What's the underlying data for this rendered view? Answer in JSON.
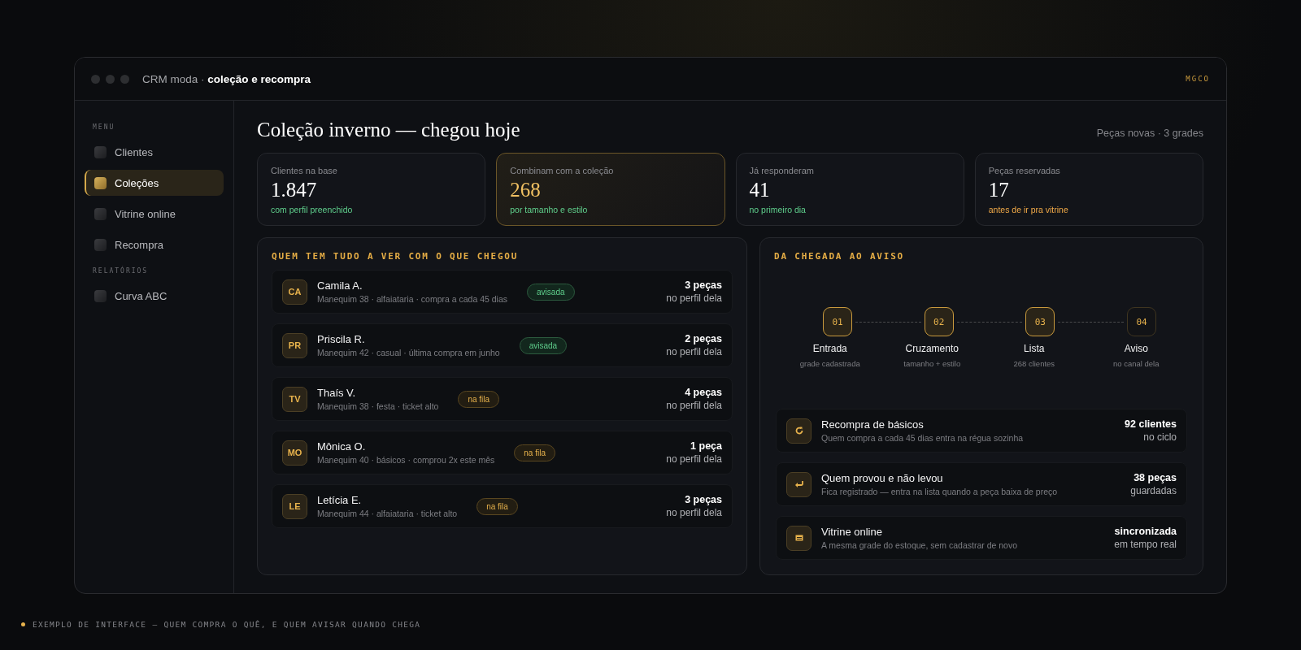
{
  "window": {
    "title_app": "CRM moda ·",
    "title_context": "coleção e recompra",
    "badge": "MGCO"
  },
  "sidebar": {
    "sections": [
      {
        "label": "MENU",
        "items": [
          {
            "label": "Clientes",
            "selected": false
          },
          {
            "label": "Coleções",
            "selected": true
          },
          {
            "label": "Vitrine online",
            "selected": false
          },
          {
            "label": "Recompra",
            "selected": false
          }
        ]
      },
      {
        "label": "RELATÓRIOS",
        "items": [
          {
            "label": "Curva ABC",
            "selected": false
          }
        ]
      }
    ]
  },
  "header": {
    "title": "Coleção inverno — chegou hoje",
    "meta": "Peças novas · 3 grades"
  },
  "stats": [
    {
      "label": "Clientes na base",
      "value": "1.847",
      "note": "com perfil preenchido",
      "highlighted": false,
      "kind": "positive"
    },
    {
      "label": "Combinam com a coleção",
      "value": "268",
      "note": "por tamanho e estilo",
      "highlighted": true,
      "kind": "positive"
    },
    {
      "label": "Já responderam",
      "value": "41",
      "note": "no primeiro dia",
      "highlighted": false,
      "kind": "positive"
    },
    {
      "label": "Peças reservadas",
      "value": "17",
      "note": "antes de ir pra vitrine",
      "highlighted": false,
      "kind": "warning"
    }
  ],
  "matches": {
    "title": "QUEM TEM TUDO A VER COM O QUE CHEGOU",
    "rows": [
      {
        "initials": "CA",
        "name": "Camila A.",
        "details": "Manequim 38 · alfaiataria · compra a cada 45 dias",
        "status": "avisada",
        "kind": "notified",
        "count": "3 peças",
        "count_note": "no perfil dela"
      },
      {
        "initials": "PR",
        "name": "Priscila R.",
        "details": "Manequim 42 · casual · última compra em junho",
        "status": "avisada",
        "kind": "notified",
        "count": "2 peças",
        "count_note": "no perfil dela"
      },
      {
        "initials": "TV",
        "name": "Thaís V.",
        "details": "Manequim 38 · festa · ticket alto",
        "status": "na fila",
        "kind": "queued",
        "count": "4 peças",
        "count_note": "no perfil dela"
      },
      {
        "initials": "MO",
        "name": "Mônica O.",
        "details": "Manequim 40 · básicos · comprou 2x este mês",
        "status": "na fila",
        "kind": "queued",
        "count": "1 peça",
        "count_note": "no perfil dela"
      },
      {
        "initials": "LE",
        "name": "Letícia E.",
        "details": "Manequim 44 · alfaiataria · ticket alto",
        "status": "na fila",
        "kind": "queued",
        "count": "3 peças",
        "count_note": "no perfil dela"
      }
    ]
  },
  "flow": {
    "title": "DA CHEGADA AO AVISO",
    "steps": [
      {
        "number": "01",
        "label": "Entrada",
        "note": "grade cadastrada",
        "done": true
      },
      {
        "number": "02",
        "label": "Cruzamento",
        "note": "tamanho + estilo",
        "done": true
      },
      {
        "number": "03",
        "label": "Lista",
        "note": "268 clientes",
        "done": true
      },
      {
        "number": "04",
        "label": "Aviso",
        "note": "no canal dela",
        "done": false
      }
    ],
    "rules": [
      {
        "kind": "repeat",
        "title": "Recompra de básicos",
        "description": "Quem compra a cada 45 dias entra na régua sozinha",
        "value": "92 clientes",
        "value_note": "no ciclo"
      },
      {
        "kind": "return",
        "title": "Quem provou e não levou",
        "description": "Fica registrado — entra na lista quando a peça baixa de preço",
        "value": "38 peças",
        "value_note": "guardadas"
      },
      {
        "kind": "storefront",
        "title": "Vitrine online",
        "description": "A mesma grade do estoque, sem cadastrar de novo",
        "value": "sincronizada",
        "value_note": "em tempo real"
      }
    ]
  },
  "footer": {
    "caption": "EXEMPLO DE INTERFACE — QUEM COMPRA O QUÊ, E QUEM AVISAR QUANDO CHEGA"
  }
}
